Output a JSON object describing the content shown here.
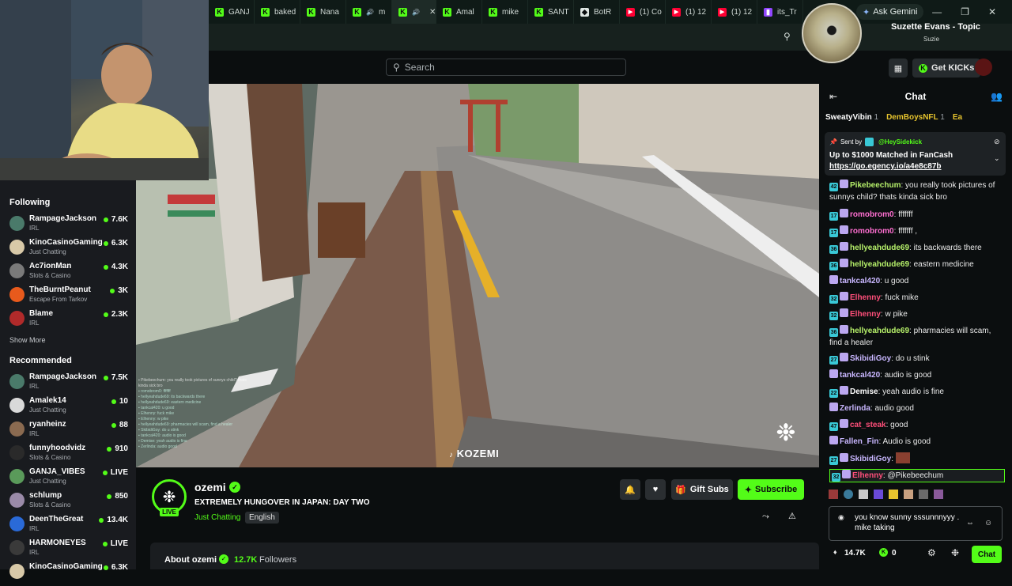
{
  "browser": {
    "tabs": [
      {
        "label": "GANJ",
        "icon": "kick"
      },
      {
        "label": "baked",
        "icon": "kick"
      },
      {
        "label": "Nana",
        "icon": "kick"
      },
      {
        "label": "m",
        "icon": "kick"
      },
      {
        "label": "",
        "icon": "kick"
      },
      {
        "label": "Amal",
        "icon": "kick"
      },
      {
        "label": "mike",
        "icon": "kick"
      },
      {
        "label": "SANT",
        "icon": "kick"
      },
      {
        "label": "BotR",
        "icon": "bot"
      },
      {
        "label": "(1) Co",
        "icon": "youtube"
      },
      {
        "label": "(1) 12",
        "icon": "youtube"
      },
      {
        "label": "(1) 12",
        "icon": "youtube"
      },
      {
        "label": "its_Tr",
        "icon": "twitch"
      }
    ],
    "ask_gemini": "Ask Gemini"
  },
  "media": {
    "title": "Suzette Evans - Topic",
    "artist": "Suzie"
  },
  "header": {
    "search_placeholder": "Search",
    "get_kicks": "Get KICKs"
  },
  "sidebar": {
    "following_title": "Following",
    "following": [
      {
        "name": "RampageJackson",
        "category": "IRL",
        "count": "7.6K",
        "color": "#4a7a6a"
      },
      {
        "name": "KinoCasinoGaming",
        "category": "Just Chatting",
        "count": "6.3K",
        "color": "#d8c9a8"
      },
      {
        "name": "Ac7ionMan",
        "category": "Slots & Casino",
        "count": "4.3K",
        "color": "#7a7a7a"
      },
      {
        "name": "TheBurntPeanut",
        "category": "Escape From Tarkov",
        "count": "3K",
        "color": "#e85a1c"
      },
      {
        "name": "Blame",
        "category": "IRL",
        "count": "2.3K",
        "color": "#b02a2a"
      }
    ],
    "show_more": "Show More",
    "recommended_title": "Recommended",
    "recommended": [
      {
        "name": "RampageJackson",
        "category": "IRL",
        "count": "7.5K",
        "color": "#4a7a6a"
      },
      {
        "name": "Amalek14",
        "category": "Just Chatting",
        "count": "10",
        "color": "#d9d9d9"
      },
      {
        "name": "ryanheinz",
        "category": "IRL",
        "count": "88",
        "color": "#8a6a50"
      },
      {
        "name": "funnyhoodvidz",
        "category": "Slots & Casino",
        "count": "910",
        "color": "#2a2a2a"
      },
      {
        "name": "GANJA_VIBES",
        "category": "Just Chatting",
        "count": "LIVE",
        "color": "#5a9a5a"
      },
      {
        "name": "schlump",
        "category": "Slots & Casino",
        "count": "850",
        "color": "#9a8aa8"
      },
      {
        "name": "DeenTheGreat",
        "category": "IRL",
        "count": "13.4K",
        "color": "#2a6ad8"
      },
      {
        "name": "HARMONEYES",
        "category": "IRL",
        "count": "LIVE",
        "color": "#3a3a3a"
      },
      {
        "name": "KinoCasinoGaming",
        "category": "",
        "count": "6.3K",
        "color": "#d8c9a8"
      }
    ]
  },
  "video": {
    "watermark": "KOZEMI"
  },
  "stream": {
    "channel": "ozemi",
    "live": "LIVE",
    "title": "EXTREMELY HUNGOVER IN JAPAN: DAY TWO",
    "category": "Just Chatting",
    "language": "English",
    "gift_subs": "Gift Subs",
    "subscribe": "Subscribe",
    "about": "About ozemi",
    "followers_count": "12.7K",
    "followers_label": "Followers"
  },
  "chat": {
    "title": "Chat",
    "gifters": [
      {
        "name": "SweatyVibin",
        "count": "1",
        "color": "#ffffff"
      },
      {
        "name": "DemBoysNFL",
        "count": "1",
        "color": "#e6c32e"
      },
      {
        "name": "Ea",
        "count": "",
        "color": "#e6c32e"
      }
    ],
    "pinned": {
      "sent_by_label": "Sent by",
      "sender": "@HeySidekick",
      "text": "Up to $1000 Matched in FanCash",
      "link": "https://go.egency.io/a4e8c87b"
    },
    "messages": [
      {
        "badges": [
          "42"
        ],
        "user": "Pikebeechum",
        "color": "#b6f06a",
        "text": "you really took pictures of sunnys child? thats kinda sick bro"
      },
      {
        "badges": [
          "17"
        ],
        "user": "romobrom0",
        "color": "#ff6fd1",
        "text": "fffffff"
      },
      {
        "badges": [
          "17"
        ],
        "user": "romobrom0",
        "color": "#ff6fd1",
        "text": "fffffff ,"
      },
      {
        "badges": [
          "36"
        ],
        "user": "hellyeahdude69",
        "color": "#b6f06a",
        "text": "its backwards there"
      },
      {
        "badges": [
          "36"
        ],
        "user": "hellyeahdude69",
        "color": "#b6f06a",
        "text": "eastern medicine"
      },
      {
        "badges": [],
        "user": "tankcal420",
        "color": "#c9b7ff",
        "text": "u good"
      },
      {
        "badges": [
          "32"
        ],
        "user": "Elhenny",
        "color": "#ff4f7a",
        "text": "fuck mike"
      },
      {
        "badges": [
          "32"
        ],
        "user": "Elhenny",
        "color": "#ff4f7a",
        "text": "w pike"
      },
      {
        "badges": [
          "36"
        ],
        "user": "hellyeahdude69",
        "color": "#b6f06a",
        "text": "pharmacies will scam, find a healer"
      },
      {
        "badges": [
          "27"
        ],
        "user": "SkibidiGoy",
        "color": "#c9b7ff",
        "text": "do u stink"
      },
      {
        "badges": [],
        "user": "tankcal420",
        "color": "#c9b7ff",
        "text": "audio is good"
      },
      {
        "badges": [
          "22"
        ],
        "user": "Demise",
        "color": "#ffffff",
        "text": "yeah audio is fine"
      },
      {
        "badges": [],
        "user": "Zerlinda",
        "color": "#c9b7ff",
        "text": "audio good"
      },
      {
        "badges": [
          "47"
        ],
        "user": "cat_steak",
        "color": "#ff4f7a",
        "text": "good"
      },
      {
        "badges": [],
        "user": "Fallen_Fin",
        "color": "#c9b7ff",
        "text": "Audio is good"
      },
      {
        "badges": [
          "27"
        ],
        "user": "SkibidiGoy",
        "color": "#c9b7ff",
        "text": ""
      },
      {
        "badges": [
          "32"
        ],
        "user": "Elhenny",
        "color": "#ff4f7a",
        "text": "@Pikebeechum"
      }
    ],
    "input_text": "you know sunny sssunnnyyy . mike taking",
    "kicks": "14.7K",
    "points": "0",
    "send": "Chat"
  }
}
